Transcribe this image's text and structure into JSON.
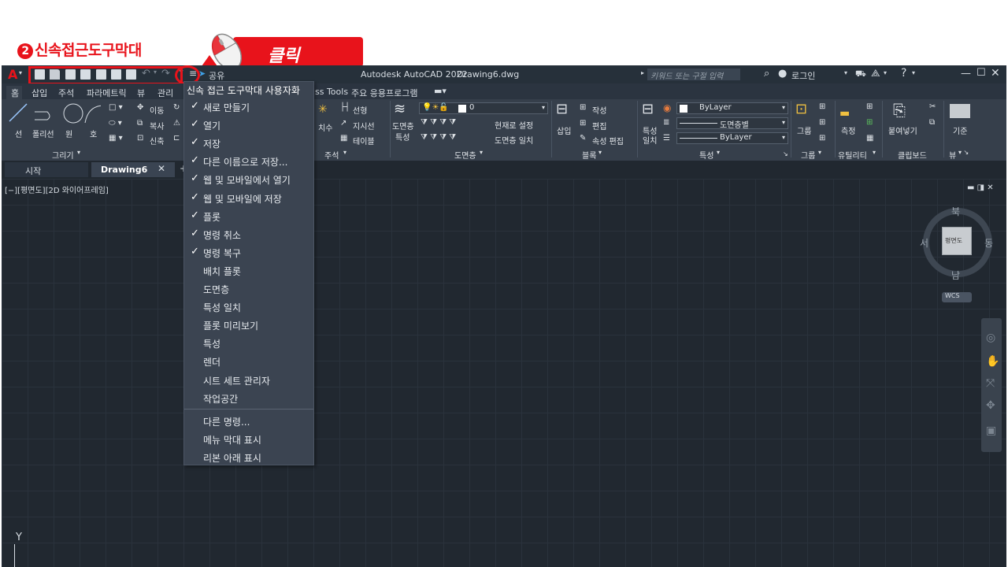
{
  "annotation": {
    "step_number": "2",
    "step_label": "신속접근도구막대",
    "click_label": "클릭"
  },
  "titlebar": {
    "share_label": "공유",
    "app_title": "Autodesk AutoCAD 2022",
    "file_name": "Drawing6.dwg",
    "search_placeholder": "키워드 또는 구절 입력",
    "login_label": "로그인"
  },
  "ribbon_tabs": [
    "홈",
    "삽입",
    "주석",
    "파라메트릭",
    "뷰",
    "관리",
    "ss Tools",
    "주요 응용프로그램"
  ],
  "ribbon": {
    "draw": {
      "line": "선",
      "polyline": "폴리선",
      "circle": "원",
      "arc": "호",
      "title": "그리기"
    },
    "modify": {
      "move": "이동",
      "copy": "복사",
      "stretch": "신축"
    },
    "annotation": {
      "linear": "선형",
      "leader": "지시선",
      "table": "테이블",
      "dimension": "치수",
      "title": "주석"
    },
    "layers": {
      "layer_props_1": "도면층",
      "layer_props_2": "특성",
      "layer_value": "0",
      "set_current": "현재로 설정",
      "match_layer": "도면층 일치",
      "title": "도면층"
    },
    "block": {
      "insert": "삽입",
      "create": "작성",
      "edit": "편집",
      "attr_edit": "속성 편집",
      "title": "블록"
    },
    "properties": {
      "match_1": "특성",
      "match_2": "일치",
      "color": "ByLayer",
      "linetype": "도면층별",
      "lineweight": "ByLayer",
      "title": "특성"
    },
    "groups": {
      "group": "그룹",
      "title": "그룹"
    },
    "utilities": {
      "measure": "측정",
      "title": "유틸리티"
    },
    "clipboard": {
      "paste": "붙여넣기",
      "title": "클립보드"
    },
    "view": {
      "base": "기준",
      "title": "뷰"
    }
  },
  "file_tabs": {
    "start": "시작",
    "drawing": "Drawing6"
  },
  "viewport_label": "[−][평면도][2D 와이어프레임]",
  "viewcube": {
    "north": "북",
    "south": "남",
    "east": "동",
    "west": "서",
    "face": "평면도",
    "wcs": "WCS"
  },
  "ucs": {
    "y_label": "Y"
  },
  "qat_menu": {
    "title": "신속 접근 도구막대 사용자화",
    "items": [
      {
        "label": "새로 만들기",
        "checked": true
      },
      {
        "label": "열기",
        "checked": true
      },
      {
        "label": "저장",
        "checked": true
      },
      {
        "label": "다른 이름으로 저장...",
        "checked": true
      },
      {
        "label": "웹 및 모바일에서 열기",
        "checked": true
      },
      {
        "label": "웹 및 모바일에 저장",
        "checked": true
      },
      {
        "label": "플롯",
        "checked": true
      },
      {
        "label": "명령 취소",
        "checked": true
      },
      {
        "label": "명령 복구",
        "checked": true
      },
      {
        "label": "배치 플롯",
        "checked": false
      },
      {
        "label": "도면층",
        "checked": false
      },
      {
        "label": "특성 일치",
        "checked": false
      },
      {
        "label": "플롯 미리보기",
        "checked": false
      },
      {
        "label": "특성",
        "checked": false
      },
      {
        "label": "렌더",
        "checked": false
      },
      {
        "label": "시트 세트 관리자",
        "checked": false
      },
      {
        "label": "작업공간",
        "checked": false
      }
    ],
    "extra_items": [
      "다른 명령...",
      "메뉴 막대 표시",
      "리본 아래 표시"
    ],
    "check_glyph": "✓"
  }
}
